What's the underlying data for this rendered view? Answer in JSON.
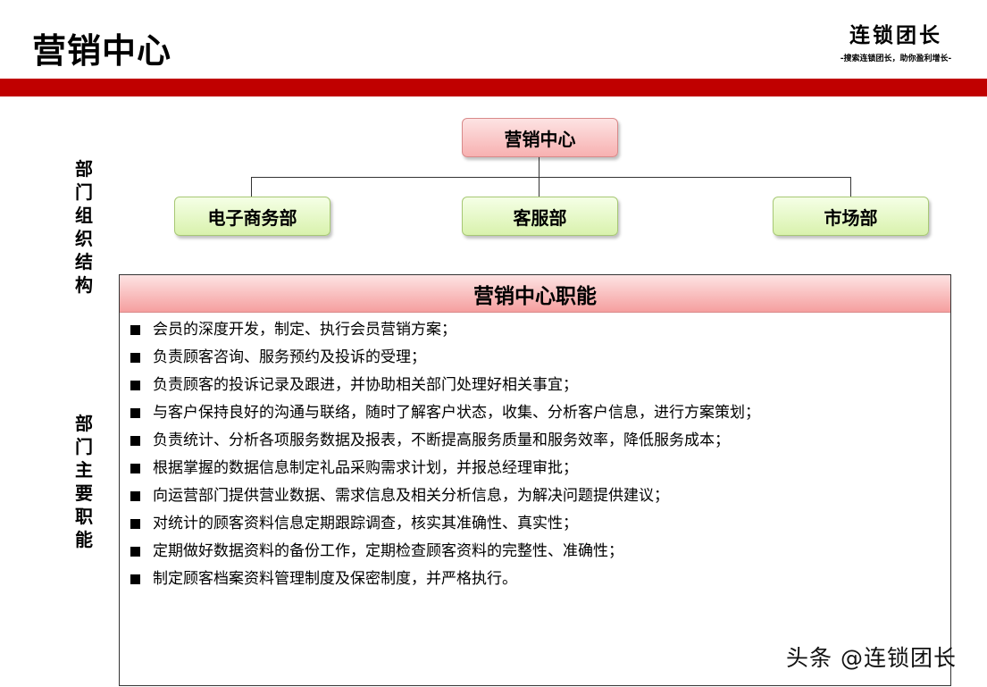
{
  "header": {
    "title": "营销中心",
    "brand_name": "连锁团长",
    "brand_slogan": "-搜索连锁团长，助你盈利增长-",
    "accent_color": "#c00000"
  },
  "side_labels": {
    "org": [
      "部",
      "门",
      "组",
      "织",
      "结",
      "构"
    ],
    "duties": [
      "部",
      "门",
      "主",
      "要",
      "职",
      "能"
    ]
  },
  "org_chart": {
    "root": "营销中心",
    "children": [
      "电子商务部",
      "客服部",
      "市场部"
    ]
  },
  "duties": {
    "title": "营销中心职能",
    "items": [
      "会员的深度开发，制定、执行会员营销方案；",
      "负责顾客咨询、服务预约及投诉的受理；",
      "负责顾客的投诉记录及跟进，并协助相关部门处理好相关事宜；",
      "与客户保持良好的沟通与联络，随时了解客户状态，收集、分析客户信息，进行方案策划；",
      "负责统计、分析各项服务数据及报表，不断提高服务质量和服务效率，降低服务成本；",
      "根据掌握的数据信息制定礼品采购需求计划，并报总经理审批；",
      "向运营部门提供营业数据、需求信息及相关分析信息，为解决问题提供建议；",
      "对统计的顾客资料信息定期跟踪调查，核实其准确性、真实性；",
      "定期做好数据资料的备份工作，定期检查顾客资料的完整性、准确性；",
      "制定顾客档案资料管理制度及保密制度，并严格执行。"
    ]
  },
  "watermark": "头条 @连锁团长"
}
